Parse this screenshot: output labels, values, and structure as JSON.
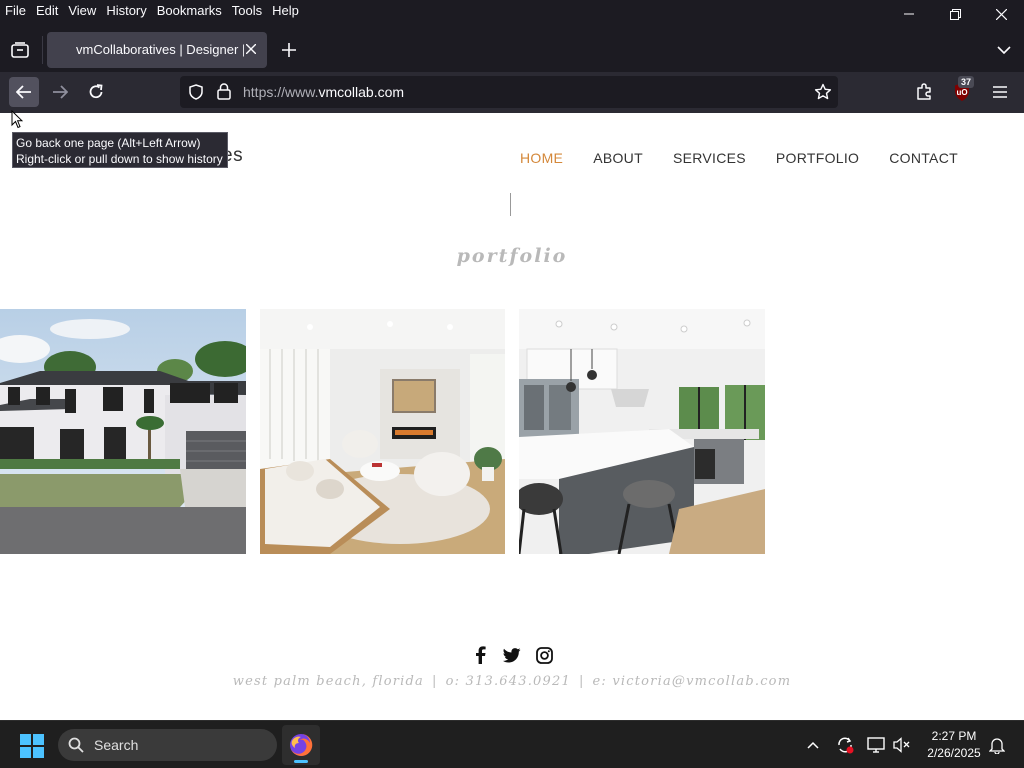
{
  "menubar": {
    "items": [
      "File",
      "Edit",
      "View",
      "History",
      "Bookmarks",
      "Tools",
      "Help"
    ]
  },
  "tab": {
    "title": "vmCollaboratives | Designer | W"
  },
  "navbar": {
    "url_prefix": "https://www.",
    "url_domain": "vmcollab.com",
    "extension_badge": "37"
  },
  "tooltip": {
    "line1": "Go back one page (Alt+Left Arrow)",
    "line2": "Right-click or pull down to show history"
  },
  "site": {
    "logo_tail": "es",
    "nav": [
      "HOME",
      "ABOUT",
      "SERVICES",
      "PORTFOLIO",
      "CONTACT"
    ],
    "active_nav": "HOME",
    "accent_color": "#d4883a",
    "section_heading": "portfolio",
    "photos": [
      {
        "icon": "house-exterior-photo"
      },
      {
        "icon": "living-room-photo"
      },
      {
        "icon": "kitchen-photo"
      }
    ],
    "footer": {
      "location": "west palm beach, florida",
      "phone": "o: 313.643.0921",
      "email": "e: victoria@vmcollab.com",
      "separator": "|"
    }
  },
  "taskbar": {
    "search_label": "Search",
    "time": "2:27 PM",
    "date": "2/26/2025"
  }
}
